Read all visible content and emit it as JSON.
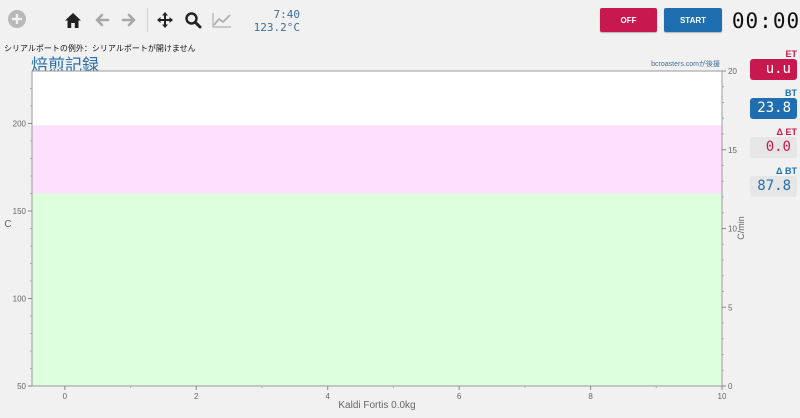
{
  "toolbar": {
    "add_icon": "plus-circle-icon",
    "home_icon": "home-icon",
    "back_icon": "arrow-left-icon",
    "forward_icon": "arrow-right-icon",
    "pan_icon": "move-icon",
    "zoom_icon": "magnifier-icon",
    "chart_icon": "line-chart-icon"
  },
  "readout": {
    "time": "7:40",
    "temp": "123.2°C"
  },
  "buttons": {
    "off_label": "OFF",
    "off_color": "#c8194e",
    "start_label": "START",
    "start_color": "#1f6fb0"
  },
  "clock": "00:00",
  "error_message": "シリアルポートの例外：シリアルポートが開けません",
  "title": "焙煎記録",
  "watermark": "bcroasters.comが後援",
  "lcds": {
    "et": {
      "label": "ET",
      "value": "u.u",
      "color": "#c8194e"
    },
    "bt": {
      "label": "BT",
      "value": "23.8",
      "color": "#1f6fb0"
    },
    "det": {
      "label": "Δ ET",
      "value": "0.0",
      "color": "#c8194e"
    },
    "dbt": {
      "label": "Δ BT",
      "value": "87.8",
      "color": "#1f6fb0"
    }
  },
  "chart_data": {
    "type": "line",
    "xlabel": "Kaldi Fortis 0.0kg",
    "ylabel": "C",
    "y2label": "C/min",
    "xlim": [
      -0.5,
      10
    ],
    "ylim": [
      50,
      230
    ],
    "y2lim": [
      0,
      20
    ],
    "x_ticks": [
      0,
      2,
      4,
      6,
      8,
      10
    ],
    "y_ticks": [
      50,
      100,
      150,
      200
    ],
    "y2_ticks": [
      0,
      5,
      10,
      15,
      20
    ],
    "bands": [
      {
        "from": 50,
        "to": 160,
        "color": "#dcfedc"
      },
      {
        "from": 160,
        "to": 199,
        "color": "#fde0fd"
      },
      {
        "from": 199,
        "to": 230,
        "color": "#ffffff"
      }
    ],
    "series": []
  }
}
